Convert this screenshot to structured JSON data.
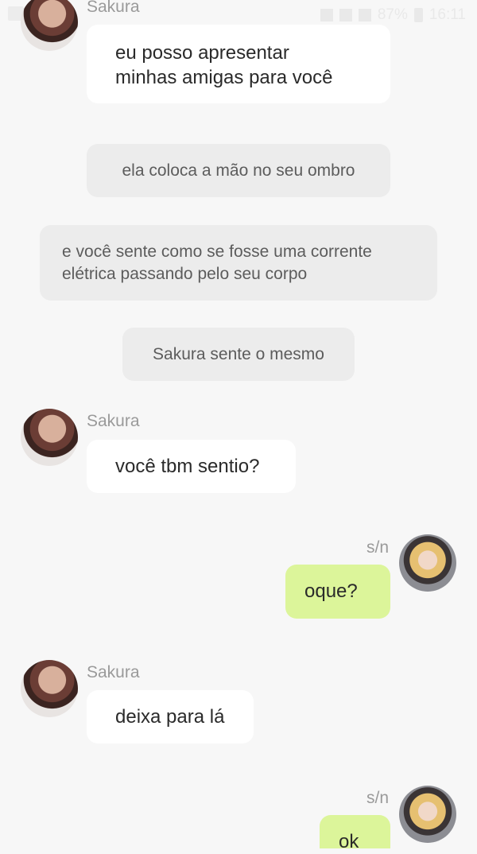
{
  "status": {
    "battery": "87%",
    "time": "16:11"
  },
  "messages": [
    {
      "sender": "Sakura",
      "lines": [
        "eu posso apresentar",
        "minhas amigas para você"
      ]
    },
    {
      "narration": "ela coloca a mão no seu ombro"
    },
    {
      "narration_lines": [
        "e você sente como se fosse uma corrente",
        "elétrica passando pelo seu corpo"
      ]
    },
    {
      "narration": "Sakura sente o mesmo"
    },
    {
      "sender": "Sakura",
      "text": "você tbm sentio?"
    },
    {
      "sender": "s/n",
      "text": "oque?"
    },
    {
      "sender": "Sakura",
      "text": "deixa para lá"
    },
    {
      "sender": "s/n",
      "text": "ok"
    }
  ]
}
